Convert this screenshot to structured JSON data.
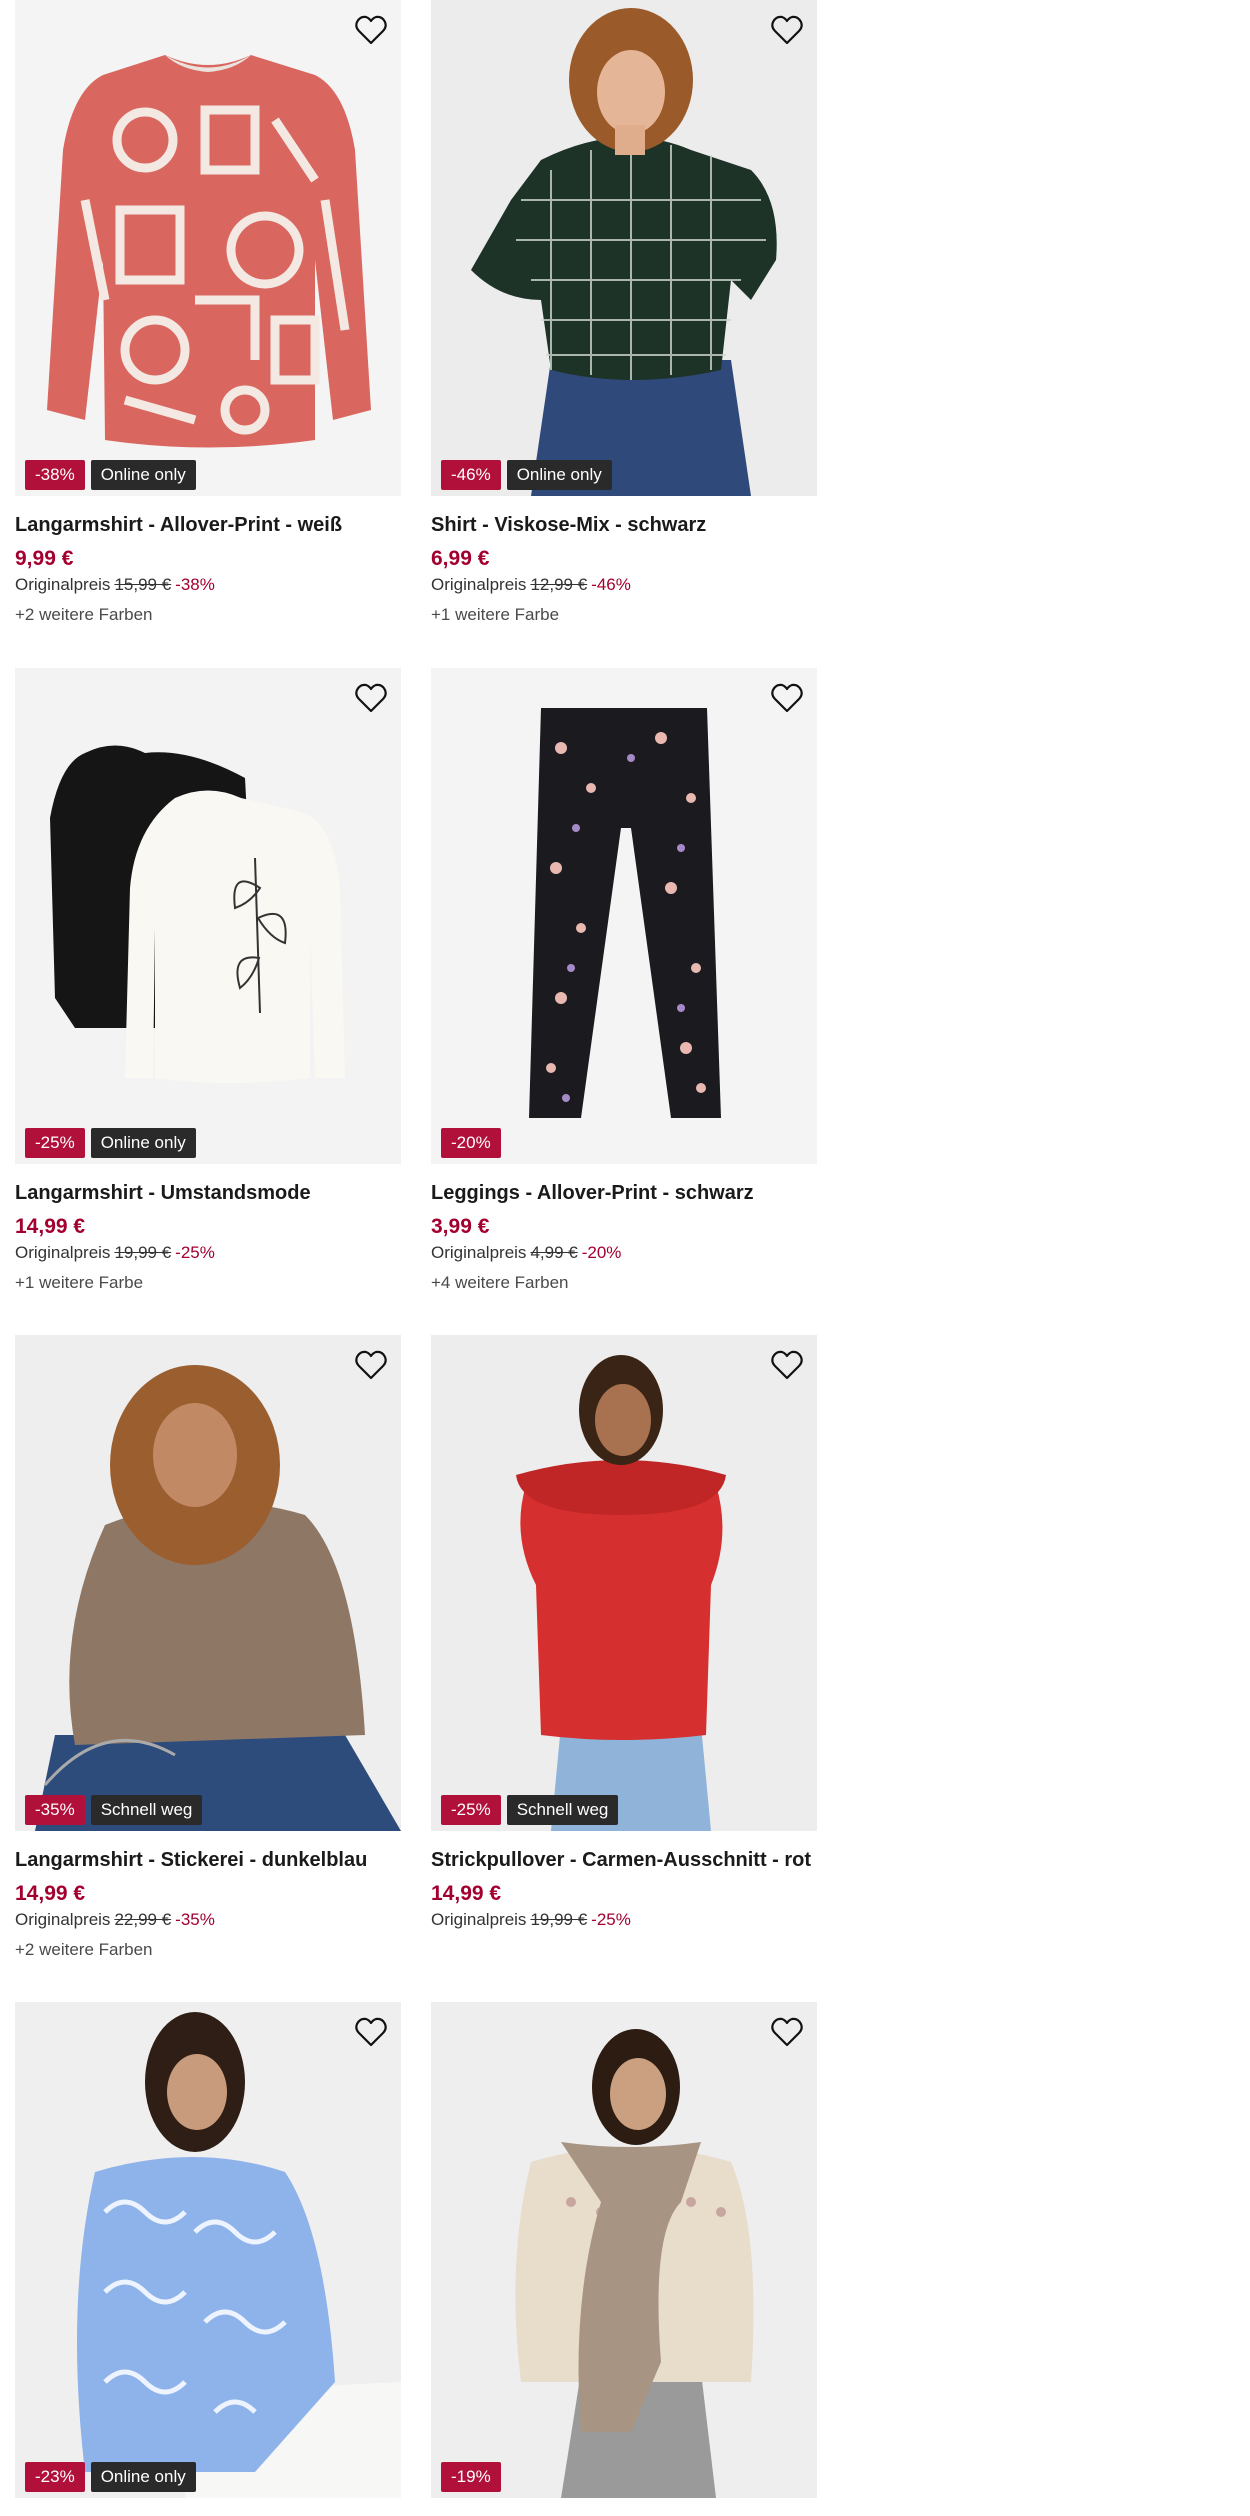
{
  "products": [
    {
      "title": "Langarmshirt - Allover-Print - weiß",
      "price": "9,99 €",
      "orig_label": "Originalpreis",
      "orig_price": "15,99 €",
      "discount": "-38%",
      "badge_discount": "-38%",
      "badge_tag": "Online only",
      "colors": "+2 weitere Farben"
    },
    {
      "title": "Shirt - Viskose-Mix - schwarz",
      "price": "6,99 €",
      "orig_label": "Originalpreis",
      "orig_price": "12,99 €",
      "discount": "-46%",
      "badge_discount": "-46%",
      "badge_tag": "Online only",
      "colors": "+1 weitere Farbe"
    },
    {
      "title": "Langarmshirt - Umstandsmode",
      "price": "14,99 €",
      "orig_label": "Originalpreis",
      "orig_price": "19,99 €",
      "discount": "-25%",
      "badge_discount": "-25%",
      "badge_tag": "Online only",
      "colors": "+1 weitere Farbe"
    },
    {
      "title": "Leggings - Allover-Print - schwarz",
      "price": "3,99 €",
      "orig_label": "Originalpreis",
      "orig_price": "4,99 €",
      "discount": "-20%",
      "badge_discount": "-20%",
      "badge_tag": "",
      "colors": "+4 weitere Farben"
    },
    {
      "title": "Langarmshirt - Stickerei - dunkelblau",
      "price": "14,99 €",
      "orig_label": "Originalpreis",
      "orig_price": "22,99 €",
      "discount": "-35%",
      "badge_discount": "-35%",
      "badge_tag": "Schnell weg",
      "colors": "+2 weitere Farben"
    },
    {
      "title": "Strickpullover - Carmen-Ausschnitt - rot",
      "price": "14,99 €",
      "orig_label": "Originalpreis",
      "orig_price": "19,99 €",
      "discount": "-25%",
      "badge_discount": "-25%",
      "badge_tag": "Schnell weg",
      "colors": ""
    },
    {
      "badge_discount": "-23%",
      "badge_tag": "Online only"
    },
    {
      "badge_discount": "-19%",
      "badge_tag": ""
    }
  ],
  "icons": {
    "favorite": "heart-outline-icon"
  },
  "colors": {
    "sale_red": "#b0103a",
    "price_red": "#a3002f",
    "tag_dark": "#2a2a2a",
    "image_bg": "#f3f3f3"
  }
}
